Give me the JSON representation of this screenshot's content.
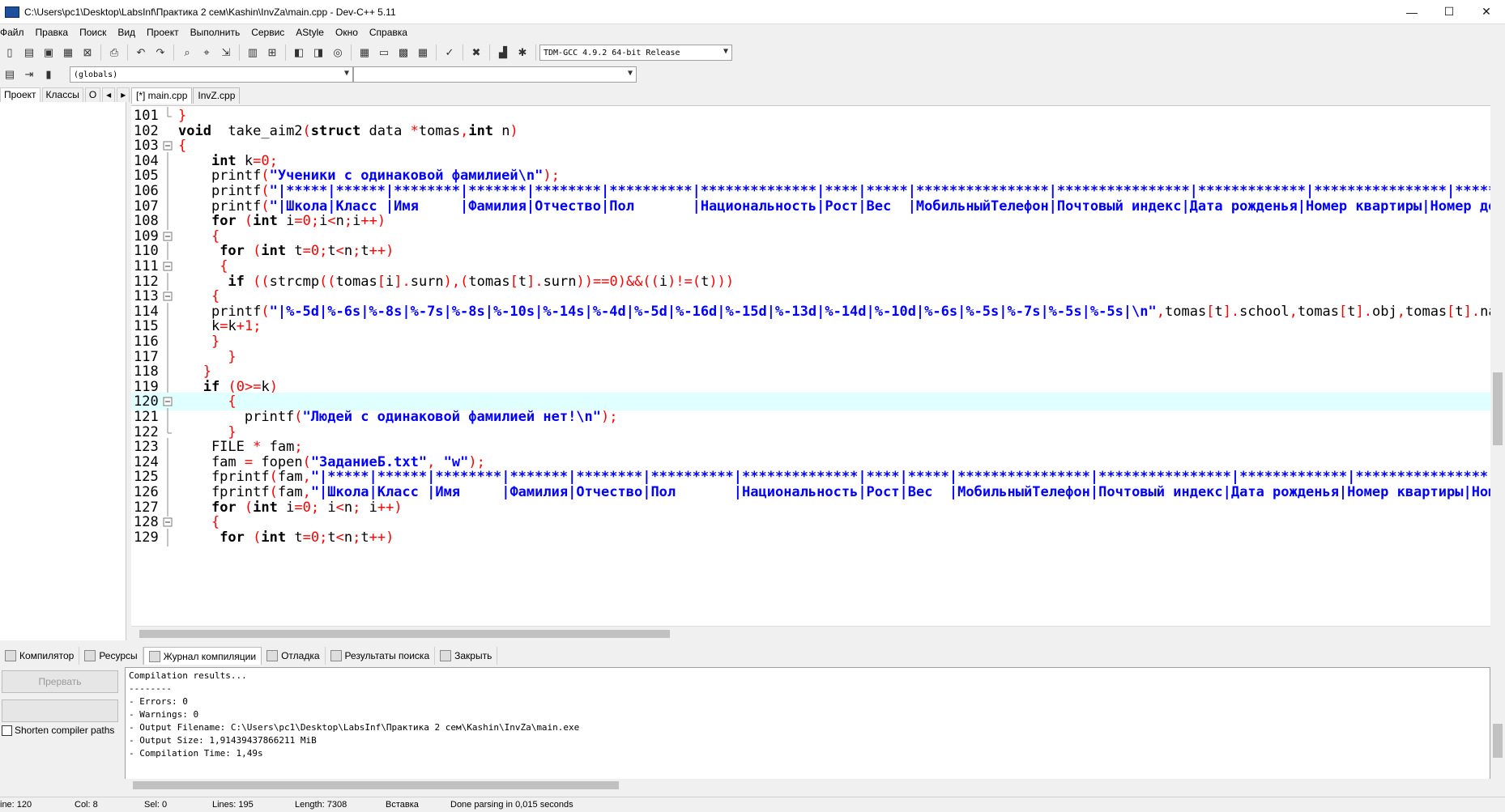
{
  "window": {
    "title": "C:\\Users\\pc1\\Desktop\\LabsInf\\Практика 2 сем\\Kashin\\InvZa\\main.cpp - Dev-C++ 5.11",
    "controls": [
      "—",
      "☐",
      "✕"
    ]
  },
  "menu": [
    "Файл",
    "Правка",
    "Поиск",
    "Вид",
    "Проект",
    "Выполнить",
    "Сервис",
    "AStyle",
    "Окно",
    "Справка"
  ],
  "compiler_select": "TDM-GCC 4.9.2 64-bit Release",
  "scope_select": "(globals)",
  "scope_select2": "",
  "left_tabs": [
    "Проект",
    "Классы",
    "О"
  ],
  "editor_tabs": [
    "[*] main.cpp",
    "InvZ.cpp"
  ],
  "code_lines": [
    {
      "num": "101",
      "fold": "end",
      "tokens": [
        [
          "p",
          "}"
        ]
      ]
    },
    {
      "num": "102",
      "fold": "",
      "tokens": [
        [
          "k",
          "void"
        ],
        [
          "v",
          "  take_aim2"
        ],
        [
          "p",
          "("
        ],
        [
          "k",
          "struct"
        ],
        [
          "v",
          " data "
        ],
        [
          "p",
          "*"
        ],
        [
          "v",
          "tomas"
        ],
        [
          "p",
          ","
        ],
        [
          "k",
          "int"
        ],
        [
          "v",
          " n"
        ],
        [
          "p",
          ")"
        ]
      ]
    },
    {
      "num": "103",
      "fold": "box",
      "tokens": [
        [
          "p",
          "{"
        ]
      ]
    },
    {
      "num": "104",
      "fold": "line",
      "tokens": [
        [
          "v",
          "    "
        ],
        [
          "k",
          "int"
        ],
        [
          "v",
          " k"
        ],
        [
          "p",
          "="
        ],
        [
          "n",
          "0"
        ],
        [
          "p",
          ";"
        ]
      ]
    },
    {
      "num": "105",
      "fold": "line",
      "tokens": [
        [
          "v",
          "    printf"
        ],
        [
          "p",
          "("
        ],
        [
          "s",
          "\"Ученики с одинаковой фамилией\\n\""
        ],
        [
          "p",
          ");"
        ]
      ]
    },
    {
      "num": "106",
      "fold": "line",
      "tokens": [
        [
          "v",
          "    printf"
        ],
        [
          "p",
          "("
        ],
        [
          "s",
          "\"|*****|******|********|*******|********|**********|**************|****|*****|****************|****************|*************|****************|**********|"
        ]
      ]
    },
    {
      "num": "107",
      "fold": "line",
      "tokens": [
        [
          "v",
          "    printf"
        ],
        [
          "p",
          "("
        ],
        [
          "s",
          "\"|Школа|Класс |Имя     |Фамилия|Отчество|Пол       |Национальность|Рост|Вес  |МобильныйТелефон|Почтовый индекс|Дата рожденья|Номер квартиры|Номер дома|"
        ]
      ]
    },
    {
      "num": "108",
      "fold": "line",
      "tokens": [
        [
          "v",
          "    "
        ],
        [
          "k",
          "for"
        ],
        [
          "v",
          " "
        ],
        [
          "p",
          "("
        ],
        [
          "k",
          "int"
        ],
        [
          "v",
          " i"
        ],
        [
          "p",
          "="
        ],
        [
          "n",
          "0"
        ],
        [
          "p",
          ";"
        ],
        [
          "v",
          "i"
        ],
        [
          "p",
          "<"
        ],
        [
          "v",
          "n"
        ],
        [
          "p",
          ";"
        ],
        [
          "v",
          "i"
        ],
        [
          "p",
          "++)"
        ]
      ]
    },
    {
      "num": "109",
      "fold": "box",
      "tokens": [
        [
          "v",
          "    "
        ],
        [
          "p",
          "{"
        ]
      ]
    },
    {
      "num": "110",
      "fold": "line",
      "tokens": [
        [
          "v",
          "     "
        ],
        [
          "k",
          "for"
        ],
        [
          "v",
          " "
        ],
        [
          "p",
          "("
        ],
        [
          "k",
          "int"
        ],
        [
          "v",
          " t"
        ],
        [
          "p",
          "="
        ],
        [
          "n",
          "0"
        ],
        [
          "p",
          ";"
        ],
        [
          "v",
          "t"
        ],
        [
          "p",
          "<"
        ],
        [
          "v",
          "n"
        ],
        [
          "p",
          ";"
        ],
        [
          "v",
          "t"
        ],
        [
          "p",
          "++)"
        ]
      ]
    },
    {
      "num": "111",
      "fold": "box",
      "tokens": [
        [
          "v",
          "     "
        ],
        [
          "p",
          "{"
        ]
      ]
    },
    {
      "num": "112",
      "fold": "line",
      "tokens": [
        [
          "v",
          "      "
        ],
        [
          "k",
          "if"
        ],
        [
          "v",
          " "
        ],
        [
          "p",
          "(("
        ],
        [
          "v",
          "strcmp"
        ],
        [
          "p",
          "(("
        ],
        [
          "v",
          "tomas"
        ],
        [
          "p",
          "["
        ],
        [
          "v",
          "i"
        ],
        [
          "p",
          "]."
        ],
        [
          "v",
          "surn"
        ],
        [
          "p",
          "),("
        ],
        [
          "v",
          "tomas"
        ],
        [
          "p",
          "["
        ],
        [
          "v",
          "t"
        ],
        [
          "p",
          "]."
        ],
        [
          "v",
          "surn"
        ],
        [
          "p",
          "))=="
        ],
        [
          "n",
          "0"
        ],
        [
          "p",
          ")&&(("
        ],
        [
          "v",
          "i"
        ],
        [
          "p",
          ")!=("
        ],
        [
          "v",
          "t"
        ],
        [
          "p",
          ")))"
        ]
      ]
    },
    {
      "num": "113",
      "fold": "box",
      "tokens": [
        [
          "v",
          "    "
        ],
        [
          "p",
          "{"
        ]
      ]
    },
    {
      "num": "114",
      "fold": "line",
      "tokens": [
        [
          "v",
          "    printf"
        ],
        [
          "p",
          "("
        ],
        [
          "s",
          "\"|%-5d|%-6s|%-8s|%-7s|%-8s|%-10s|%-14s|%-4d|%-5d|%-16d|%-15d|%-13d|%-14d|%-10d|%-6s|%-5s|%-7s|%-5s|%-5s|\\n\""
        ],
        [
          "p",
          ","
        ],
        [
          "v",
          "tomas"
        ],
        [
          "p",
          "["
        ],
        [
          "v",
          "t"
        ],
        [
          "p",
          "]."
        ],
        [
          "v",
          "school"
        ],
        [
          "p",
          ","
        ],
        [
          "v",
          "tomas"
        ],
        [
          "p",
          "["
        ],
        [
          "v",
          "t"
        ],
        [
          "p",
          "]."
        ],
        [
          "v",
          "obj"
        ],
        [
          "p",
          ","
        ],
        [
          "v",
          "tomas"
        ],
        [
          "p",
          "["
        ],
        [
          "v",
          "t"
        ],
        [
          "p",
          "]."
        ],
        [
          "v",
          "name"
        ],
        [
          "p",
          ","
        ]
      ]
    },
    {
      "num": "115",
      "fold": "line",
      "tokens": [
        [
          "v",
          "    k"
        ],
        [
          "p",
          "="
        ],
        [
          "v",
          "k"
        ],
        [
          "p",
          "+"
        ],
        [
          "n",
          "1"
        ],
        [
          "p",
          ";"
        ]
      ]
    },
    {
      "num": "116",
      "fold": "line",
      "tokens": [
        [
          "v",
          "    "
        ],
        [
          "p",
          "}"
        ]
      ]
    },
    {
      "num": "117",
      "fold": "line",
      "tokens": [
        [
          "v",
          "      "
        ],
        [
          "p",
          "}"
        ]
      ]
    },
    {
      "num": "118",
      "fold": "line",
      "tokens": [
        [
          "v",
          "   "
        ],
        [
          "p",
          "}"
        ]
      ]
    },
    {
      "num": "119",
      "fold": "line",
      "tokens": [
        [
          "v",
          "   "
        ],
        [
          "k",
          "if"
        ],
        [
          "v",
          " "
        ],
        [
          "p",
          "("
        ],
        [
          "n",
          "0"
        ],
        [
          "p",
          ">="
        ],
        [
          "v",
          "k"
        ],
        [
          "p",
          ")"
        ]
      ]
    },
    {
      "num": "120",
      "fold": "box",
      "hl": true,
      "tokens": [
        [
          "v",
          "      "
        ],
        [
          "p",
          "{"
        ]
      ]
    },
    {
      "num": "121",
      "fold": "line",
      "tokens": [
        [
          "v",
          "        printf"
        ],
        [
          "p",
          "("
        ],
        [
          "s",
          "\"Людей с одинаковой фамилией нет!\\n\""
        ],
        [
          "p",
          ");"
        ]
      ]
    },
    {
      "num": "122",
      "fold": "end",
      "tokens": [
        [
          "v",
          "      "
        ],
        [
          "p",
          "}"
        ]
      ]
    },
    {
      "num": "123",
      "fold": "line",
      "tokens": [
        [
          "v",
          "    FILE "
        ],
        [
          "p",
          "*"
        ],
        [
          "v",
          " fam"
        ],
        [
          "p",
          ";"
        ]
      ]
    },
    {
      "num": "124",
      "fold": "line",
      "tokens": [
        [
          "v",
          "    fam "
        ],
        [
          "p",
          "="
        ],
        [
          "v",
          " fopen"
        ],
        [
          "p",
          "("
        ],
        [
          "s",
          "\"ЗаданиеБ.txt\""
        ],
        [
          "p",
          ","
        ],
        [
          "v",
          " "
        ],
        [
          "s",
          "\"w\""
        ],
        [
          "p",
          ");"
        ]
      ]
    },
    {
      "num": "125",
      "fold": "line",
      "tokens": [
        [
          "v",
          "    fprintf"
        ],
        [
          "p",
          "("
        ],
        [
          "v",
          "fam"
        ],
        [
          "p",
          ","
        ],
        [
          "s",
          "\"|*****|******|********|*******|********|**********|**************|****|*****|****************|****************|*************|****************|******"
        ]
      ]
    },
    {
      "num": "126",
      "fold": "line",
      "tokens": [
        [
          "v",
          "    fprintf"
        ],
        [
          "p",
          "("
        ],
        [
          "v",
          "fam"
        ],
        [
          "p",
          ","
        ],
        [
          "s",
          "\"|Школа|Класс |Имя     |Фамилия|Отчество|Пол       |Национальность|Рост|Вес  |МобильныйТелефон|Почтовый индекс|Дата рожденья|Номер квартиры|Номер"
        ]
      ]
    },
    {
      "num": "127",
      "fold": "line",
      "tokens": [
        [
          "v",
          "    "
        ],
        [
          "k",
          "for"
        ],
        [
          "v",
          " "
        ],
        [
          "p",
          "("
        ],
        [
          "k",
          "int"
        ],
        [
          "v",
          " i"
        ],
        [
          "p",
          "="
        ],
        [
          "n",
          "0"
        ],
        [
          "p",
          ";"
        ],
        [
          "v",
          " i"
        ],
        [
          "p",
          "<"
        ],
        [
          "v",
          "n"
        ],
        [
          "p",
          ";"
        ],
        [
          "v",
          " i"
        ],
        [
          "p",
          "++)"
        ]
      ]
    },
    {
      "num": "128",
      "fold": "box",
      "tokens": [
        [
          "v",
          "    "
        ],
        [
          "p",
          "{"
        ]
      ]
    },
    {
      "num": "129",
      "fold": "line",
      "tokens": [
        [
          "v",
          "     "
        ],
        [
          "k",
          "for"
        ],
        [
          "v",
          " "
        ],
        [
          "p",
          "("
        ],
        [
          "k",
          "int"
        ],
        [
          "v",
          " t"
        ],
        [
          "p",
          "="
        ],
        [
          "n",
          "0"
        ],
        [
          "p",
          ";"
        ],
        [
          "v",
          "t"
        ],
        [
          "p",
          "<"
        ],
        [
          "v",
          "n"
        ],
        [
          "p",
          ";"
        ],
        [
          "v",
          "t"
        ],
        [
          "p",
          "++)"
        ]
      ]
    }
  ],
  "bottom_tabs": [
    "Компилятор",
    "Ресурсы",
    "Журнал компиляции",
    "Отладка",
    "Результаты поиска",
    "Закрыть"
  ],
  "abort_button": "Прервать",
  "shorten_paths_label": "Shorten compiler paths",
  "log_lines": [
    "Compilation results...",
    "--------",
    "- Errors: 0",
    "- Warnings: 0",
    "- Output Filename: C:\\Users\\pc1\\Desktop\\LabsInf\\Практика 2 сем\\Kashin\\InvZa\\main.exe",
    "- Output Size: 1,91439437866211 MiB",
    "- Compilation Time: 1,49s"
  ],
  "status": {
    "line": "ine:    120",
    "col": "Col:     8",
    "sel": "Sel:     0",
    "lines": "Lines:    195",
    "length": "Length:   7308",
    "mode": "Вставка",
    "message": "Done parsing in 0,015 seconds"
  }
}
